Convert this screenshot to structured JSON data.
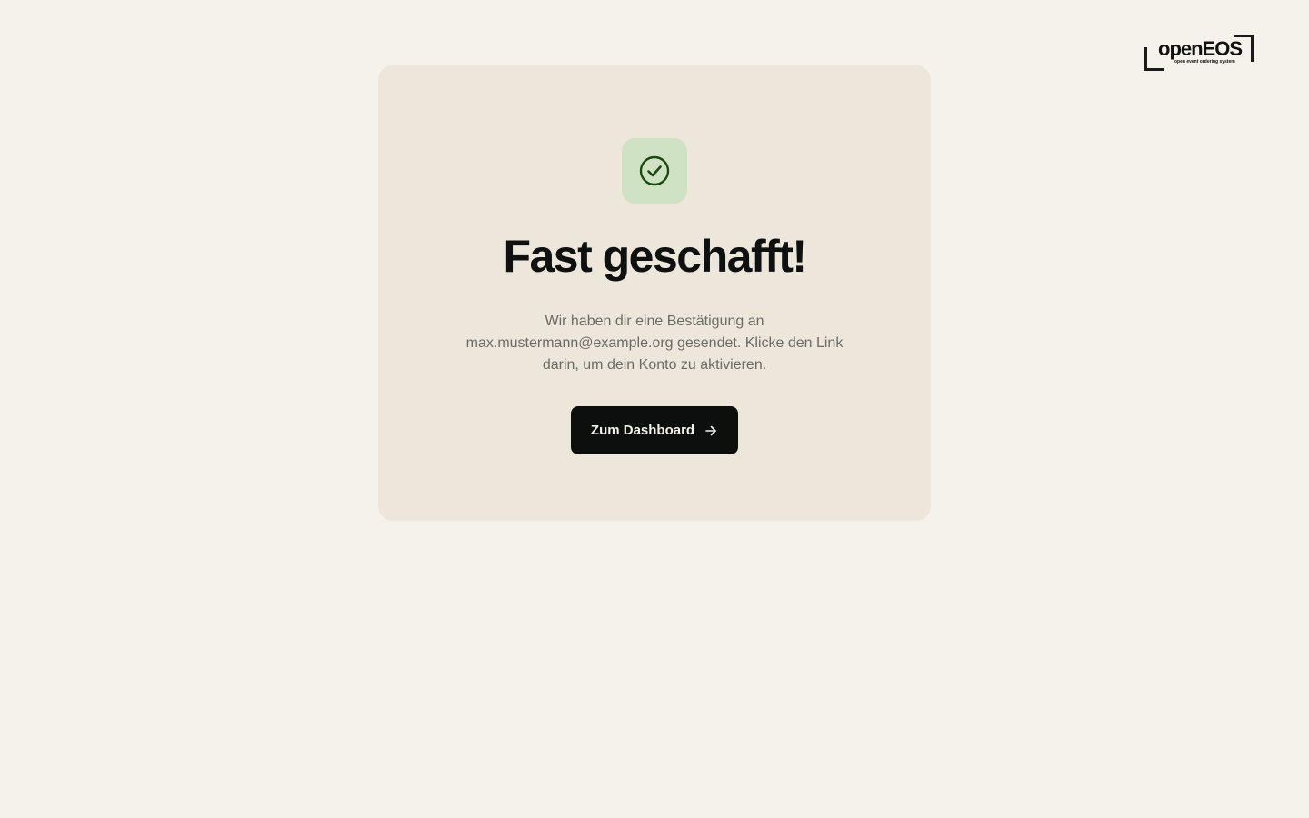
{
  "brand": {
    "wordmark": "openEOS",
    "tagline": "open event ordering system"
  },
  "confirmation": {
    "icon": "check-circle-icon",
    "title": "Fast geschafft!",
    "message": "Wir haben dir eine Bestätigung an max.mustermann@example.org gesendet. Klicke den Link darin, um dein Konto zu aktivieren.",
    "button_label": "Zum Dashboard",
    "button_icon": "arrow-right-icon"
  },
  "colors": {
    "background": "#f5f2eb",
    "card": "#ede7db",
    "success_badge": "#cfe3c4",
    "success_icon": "#1c4a12",
    "button": "#0d0f0e"
  }
}
